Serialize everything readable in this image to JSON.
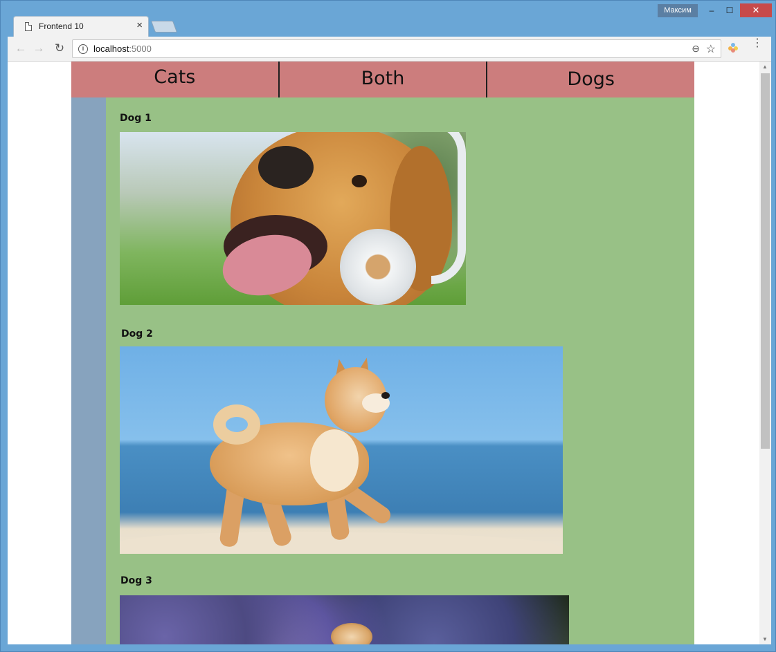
{
  "browser": {
    "tab_title": "Frontend 10",
    "tab_close": "×",
    "user_badge": "Максим",
    "window_controls": {
      "minimize": "–",
      "maximize": "☐",
      "close": "✕"
    },
    "url_host": "localhost",
    "url_port": ":5000"
  },
  "nav": {
    "items": [
      {
        "label": "Cats"
      },
      {
        "label": "Both"
      },
      {
        "label": "Dogs"
      }
    ]
  },
  "cards": [
    {
      "title": "Dog 1",
      "image_desc": "golden retriever wearing headphones"
    },
    {
      "title": "Dog 2",
      "image_desc": "shiba inu running on beach"
    },
    {
      "title": "Dog 3",
      "image_desc": "dog paw among hydrangeas"
    }
  ],
  "colors": {
    "nav_bg": "#cc7d7d",
    "left_strip": "#87a3be",
    "main_bg": "#98c186",
    "window_frame": "#6aa6d6"
  }
}
